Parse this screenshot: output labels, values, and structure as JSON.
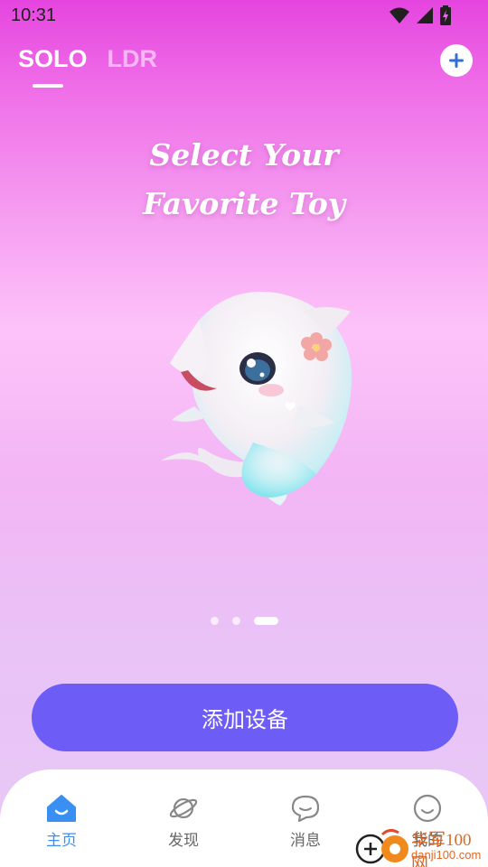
{
  "status_bar": {
    "time": "10:31"
  },
  "tabs": [
    {
      "label": "SOLO",
      "active": true
    },
    {
      "label": "LDR",
      "active": false
    }
  ],
  "headline": {
    "line1": "Select Your",
    "line2": "Favorite Toy"
  },
  "carousel": {
    "total": 3,
    "active_index": 2
  },
  "primary_button": {
    "label": "添加设备"
  },
  "bottom_nav": [
    {
      "label": "主页",
      "icon": "home-icon",
      "active": true
    },
    {
      "label": "发现",
      "icon": "planet-icon",
      "active": false
    },
    {
      "label": "消息",
      "icon": "chat-bubble-icon",
      "active": false
    },
    {
      "label": "我的",
      "icon": "smiley-icon",
      "active": false
    }
  ],
  "watermark": {
    "brand": "华军100网",
    "url": "danji100.com"
  },
  "colors": {
    "accent_button": "#6e5cf6",
    "nav_active": "#3a8ff2",
    "nav_inactive": "#666666",
    "add_icon": "#2f6fd6"
  }
}
